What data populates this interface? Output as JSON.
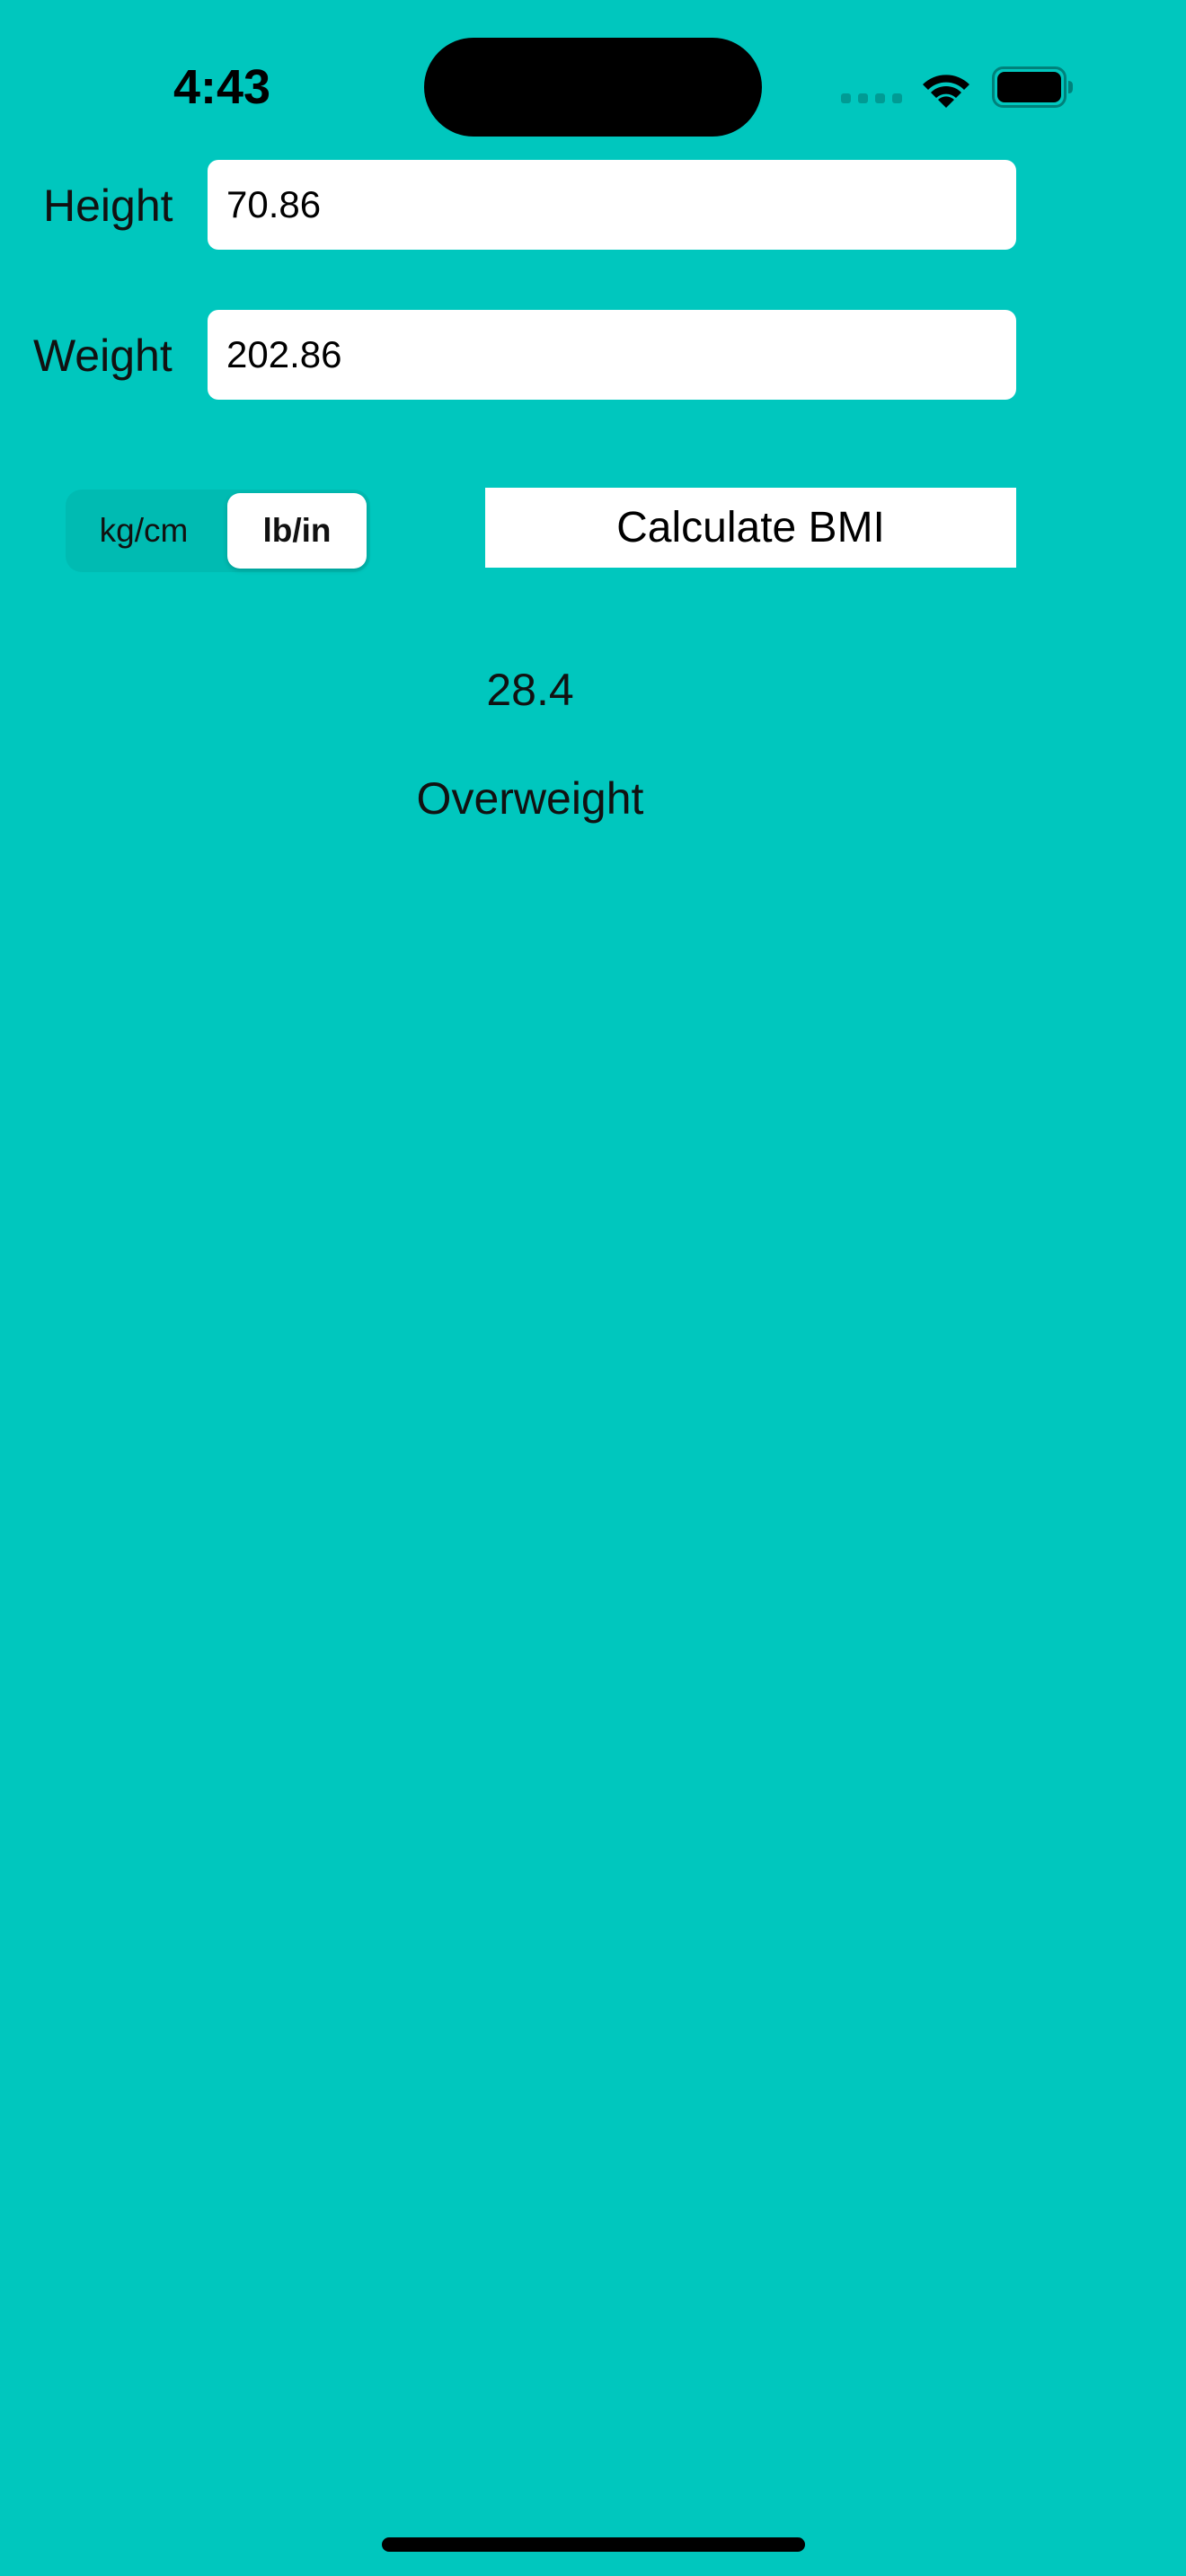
{
  "status_bar": {
    "time": "4:43"
  },
  "form": {
    "height_label": "Height",
    "height_value": "70.86",
    "weight_label": "Weight",
    "weight_value": "202.86"
  },
  "units": {
    "options": [
      "kg/cm",
      "lb/in"
    ],
    "selected": "lb/in"
  },
  "calculate_button_label": "Calculate BMI",
  "result": {
    "bmi": "28.4",
    "category": "Overweight"
  },
  "colors": {
    "background": "#00C7BE",
    "field_background": "#FFFFFF",
    "text": "#111111"
  },
  "icons": {
    "wifi": "wifi-icon",
    "battery": "battery-icon",
    "cellular": "cellular-signal-icon"
  }
}
